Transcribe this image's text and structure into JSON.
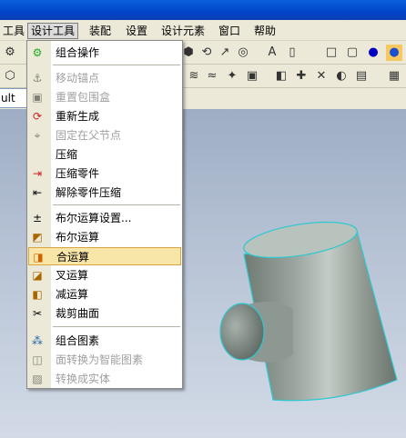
{
  "menubar": {
    "items": [
      {
        "label": "工具"
      },
      {
        "label": "设计工具"
      },
      {
        "label": "装配"
      },
      {
        "label": "设置"
      },
      {
        "label": "设计元素"
      },
      {
        "label": "窗口"
      },
      {
        "label": "帮助"
      }
    ],
    "active_index": 1
  },
  "left_panel": {
    "text": "ult"
  },
  "dropdown": {
    "items": [
      {
        "label": "组合操作",
        "icon": "combine-op-icon",
        "disabled": false
      },
      {
        "label": "移动锚点",
        "icon": "move-anchor-icon",
        "disabled": true
      },
      {
        "label": "重置包围盒",
        "icon": "reset-bbox-icon",
        "disabled": true
      },
      {
        "label": "重新生成",
        "icon": "regenerate-icon",
        "disabled": false
      },
      {
        "label": "固定在父节点",
        "icon": "fix-to-parent-icon",
        "disabled": true
      },
      {
        "label": "压缩",
        "icon": "compress-icon",
        "disabled": false
      },
      {
        "label": "压缩零件",
        "icon": "compress-part-icon",
        "disabled": false
      },
      {
        "label": "解除零件压缩",
        "icon": "uncompress-part-icon",
        "disabled": false
      },
      {
        "label": "布尔运算设置...",
        "icon": "boolean-settings-icon",
        "disabled": false
      },
      {
        "label": "布尔运算",
        "icon": "boolean-op-icon",
        "disabled": false
      },
      {
        "label": "合运算",
        "icon": "union-op-icon",
        "disabled": false,
        "highlighted": true
      },
      {
        "label": "叉运算",
        "icon": "intersect-op-icon",
        "disabled": false
      },
      {
        "label": "减运算",
        "icon": "subtract-op-icon",
        "disabled": false
      },
      {
        "label": "裁剪曲面",
        "icon": "trim-surface-icon",
        "disabled": false
      },
      {
        "label": "组合图素",
        "icon": "group-shapes-icon",
        "disabled": false
      },
      {
        "label": "面转换为智能图素",
        "icon": "face-to-smart-icon",
        "disabled": true
      },
      {
        "label": "转换成实体",
        "icon": "to-solid-icon",
        "disabled": true
      }
    ]
  },
  "colors": {
    "menu_highlight_bg": "#f8e5a8",
    "menu_highlight_border": "#d9a441",
    "cylinder_edge": "#2ec8d0",
    "titlebar": "#0a5fdc"
  }
}
